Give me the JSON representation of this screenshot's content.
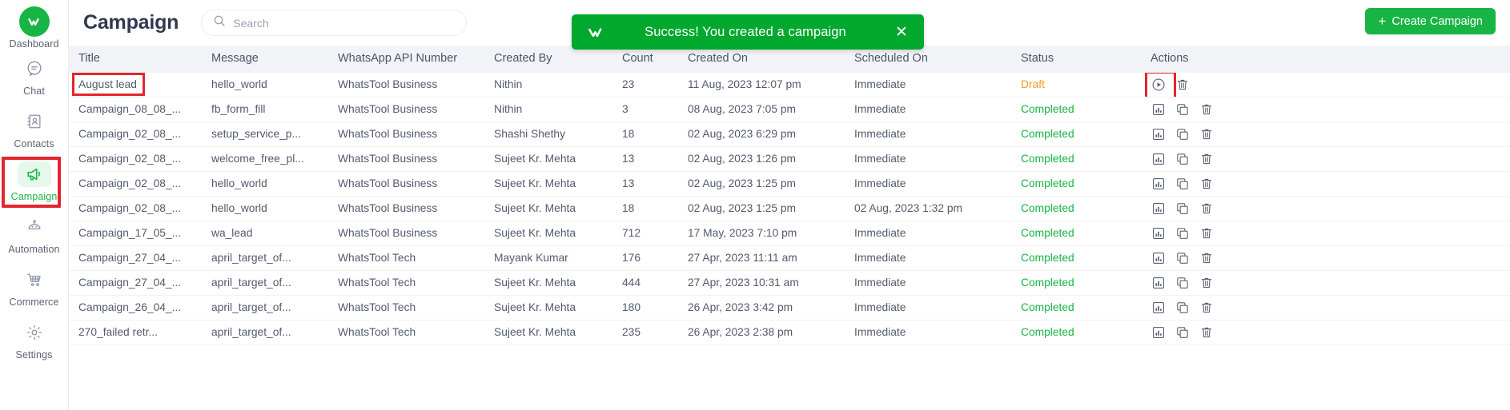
{
  "app": {
    "logo_icon": "whatstool-logo-icon",
    "brand_color": "#18b544"
  },
  "sidebar": {
    "items": [
      {
        "label": "Dashboard",
        "icon": "dashboard-logo-icon",
        "active": false
      },
      {
        "label": "Chat",
        "icon": "chat-bubble-icon",
        "active": false
      },
      {
        "label": "Contacts",
        "icon": "contacts-book-icon",
        "active": false
      },
      {
        "label": "Campaign",
        "icon": "megaphone-icon",
        "active": true
      },
      {
        "label": "Automation",
        "icon": "robot-icon",
        "active": false
      },
      {
        "label": "Commerce",
        "icon": "shopping-cart-icon",
        "active": false
      },
      {
        "label": "Settings",
        "icon": "gear-icon",
        "active": false
      }
    ]
  },
  "header": {
    "title": "Campaign",
    "search": {
      "value": "",
      "placeholder": "Search",
      "icon": "search-icon"
    },
    "create_button": {
      "label": "Create Campaign",
      "icon": "plus-icon",
      "color": "#18b544"
    }
  },
  "toast": {
    "message": "Success! You created a campaign",
    "icon": "check-mark-icon",
    "close_icon": "close-icon",
    "background": "#00a82d"
  },
  "table": {
    "columns": [
      "Title",
      "Message",
      "WhatsApp API Number",
      "Created By",
      "Count",
      "Created On",
      "Scheduled On",
      "Status",
      "Actions"
    ],
    "status_colors": {
      "Completed": "#18b544",
      "Draft": "#f0a020"
    },
    "rows": [
      {
        "title": "August lead",
        "message": "hello_world",
        "api_number": "WhatsTool Business",
        "created_by": "Nithin",
        "count": "23",
        "created_on": "11 Aug, 2023 12:07 pm",
        "scheduled_on": "Immediate",
        "status": "Draft",
        "actions": [
          "play-circle-icon",
          "trash-icon"
        ],
        "highlight_title": true,
        "highlight_first_action": true
      },
      {
        "title": "Campaign_08_08_...",
        "message": "fb_form_fill",
        "api_number": "WhatsTool Business",
        "created_by": "Nithin",
        "count": "3",
        "created_on": "08 Aug, 2023 7:05 pm",
        "scheduled_on": "Immediate",
        "status": "Completed",
        "actions": [
          "bar-chart-icon",
          "copy-icon",
          "trash-icon"
        ],
        "highlight_title": false,
        "highlight_first_action": false
      },
      {
        "title": "Campaign_02_08_...",
        "message": "setup_service_p...",
        "api_number": "WhatsTool Business",
        "created_by": "Shashi Shethy",
        "count": "18",
        "created_on": "02 Aug, 2023 6:29 pm",
        "scheduled_on": "Immediate",
        "status": "Completed",
        "actions": [
          "bar-chart-icon",
          "copy-icon",
          "trash-icon"
        ],
        "highlight_title": false,
        "highlight_first_action": false
      },
      {
        "title": "Campaign_02_08_...",
        "message": "welcome_free_pl...",
        "api_number": "WhatsTool Business",
        "created_by": "Sujeet Kr. Mehta",
        "count": "13",
        "created_on": "02 Aug, 2023 1:26 pm",
        "scheduled_on": "Immediate",
        "status": "Completed",
        "actions": [
          "bar-chart-icon",
          "copy-icon",
          "trash-icon"
        ],
        "highlight_title": false,
        "highlight_first_action": false
      },
      {
        "title": "Campaign_02_08_...",
        "message": "hello_world",
        "api_number": "WhatsTool Business",
        "created_by": "Sujeet Kr. Mehta",
        "count": "13",
        "created_on": "02 Aug, 2023 1:25 pm",
        "scheduled_on": "Immediate",
        "status": "Completed",
        "actions": [
          "bar-chart-icon",
          "copy-icon",
          "trash-icon"
        ],
        "highlight_title": false,
        "highlight_first_action": false
      },
      {
        "title": "Campaign_02_08_...",
        "message": "hello_world",
        "api_number": "WhatsTool Business",
        "created_by": "Sujeet Kr. Mehta",
        "count": "18",
        "created_on": "02 Aug, 2023 1:25 pm",
        "scheduled_on": "02 Aug, 2023 1:32 pm",
        "status": "Completed",
        "actions": [
          "bar-chart-icon",
          "copy-icon",
          "trash-icon"
        ],
        "highlight_title": false,
        "highlight_first_action": false
      },
      {
        "title": "Campaign_17_05_...",
        "message": "wa_lead",
        "api_number": "WhatsTool Business",
        "created_by": "Sujeet Kr. Mehta",
        "count": "712",
        "created_on": "17 May, 2023 7:10 pm",
        "scheduled_on": "Immediate",
        "status": "Completed",
        "actions": [
          "bar-chart-icon",
          "copy-icon",
          "trash-icon"
        ],
        "highlight_title": false,
        "highlight_first_action": false
      },
      {
        "title": "Campaign_27_04_...",
        "message": "april_target_of...",
        "api_number": "WhatsTool Tech",
        "created_by": "Mayank Kumar",
        "count": "176",
        "created_on": "27 Apr, 2023 11:11 am",
        "scheduled_on": "Immediate",
        "status": "Completed",
        "actions": [
          "bar-chart-icon",
          "copy-icon",
          "trash-icon"
        ],
        "highlight_title": false,
        "highlight_first_action": false
      },
      {
        "title": "Campaign_27_04_...",
        "message": "april_target_of...",
        "api_number": "WhatsTool Tech",
        "created_by": "Sujeet Kr. Mehta",
        "count": "444",
        "created_on": "27 Apr, 2023 10:31 am",
        "scheduled_on": "Immediate",
        "status": "Completed",
        "actions": [
          "bar-chart-icon",
          "copy-icon",
          "trash-icon"
        ],
        "highlight_title": false,
        "highlight_first_action": false
      },
      {
        "title": "Campaign_26_04_...",
        "message": "april_target_of...",
        "api_number": "WhatsTool Tech",
        "created_by": "Sujeet Kr. Mehta",
        "count": "180",
        "created_on": "26 Apr, 2023 3:42 pm",
        "scheduled_on": "Immediate",
        "status": "Completed",
        "actions": [
          "bar-chart-icon",
          "copy-icon",
          "trash-icon"
        ],
        "highlight_title": false,
        "highlight_first_action": false
      },
      {
        "title": "270_failed retr...",
        "message": "april_target_of...",
        "api_number": "WhatsTool Tech",
        "created_by": "Sujeet Kr. Mehta",
        "count": "235",
        "created_on": "26 Apr, 2023 2:38 pm",
        "scheduled_on": "Immediate",
        "status": "Completed",
        "actions": [
          "bar-chart-icon",
          "copy-icon",
          "trash-icon"
        ],
        "highlight_title": false,
        "highlight_first_action": false
      }
    ]
  }
}
